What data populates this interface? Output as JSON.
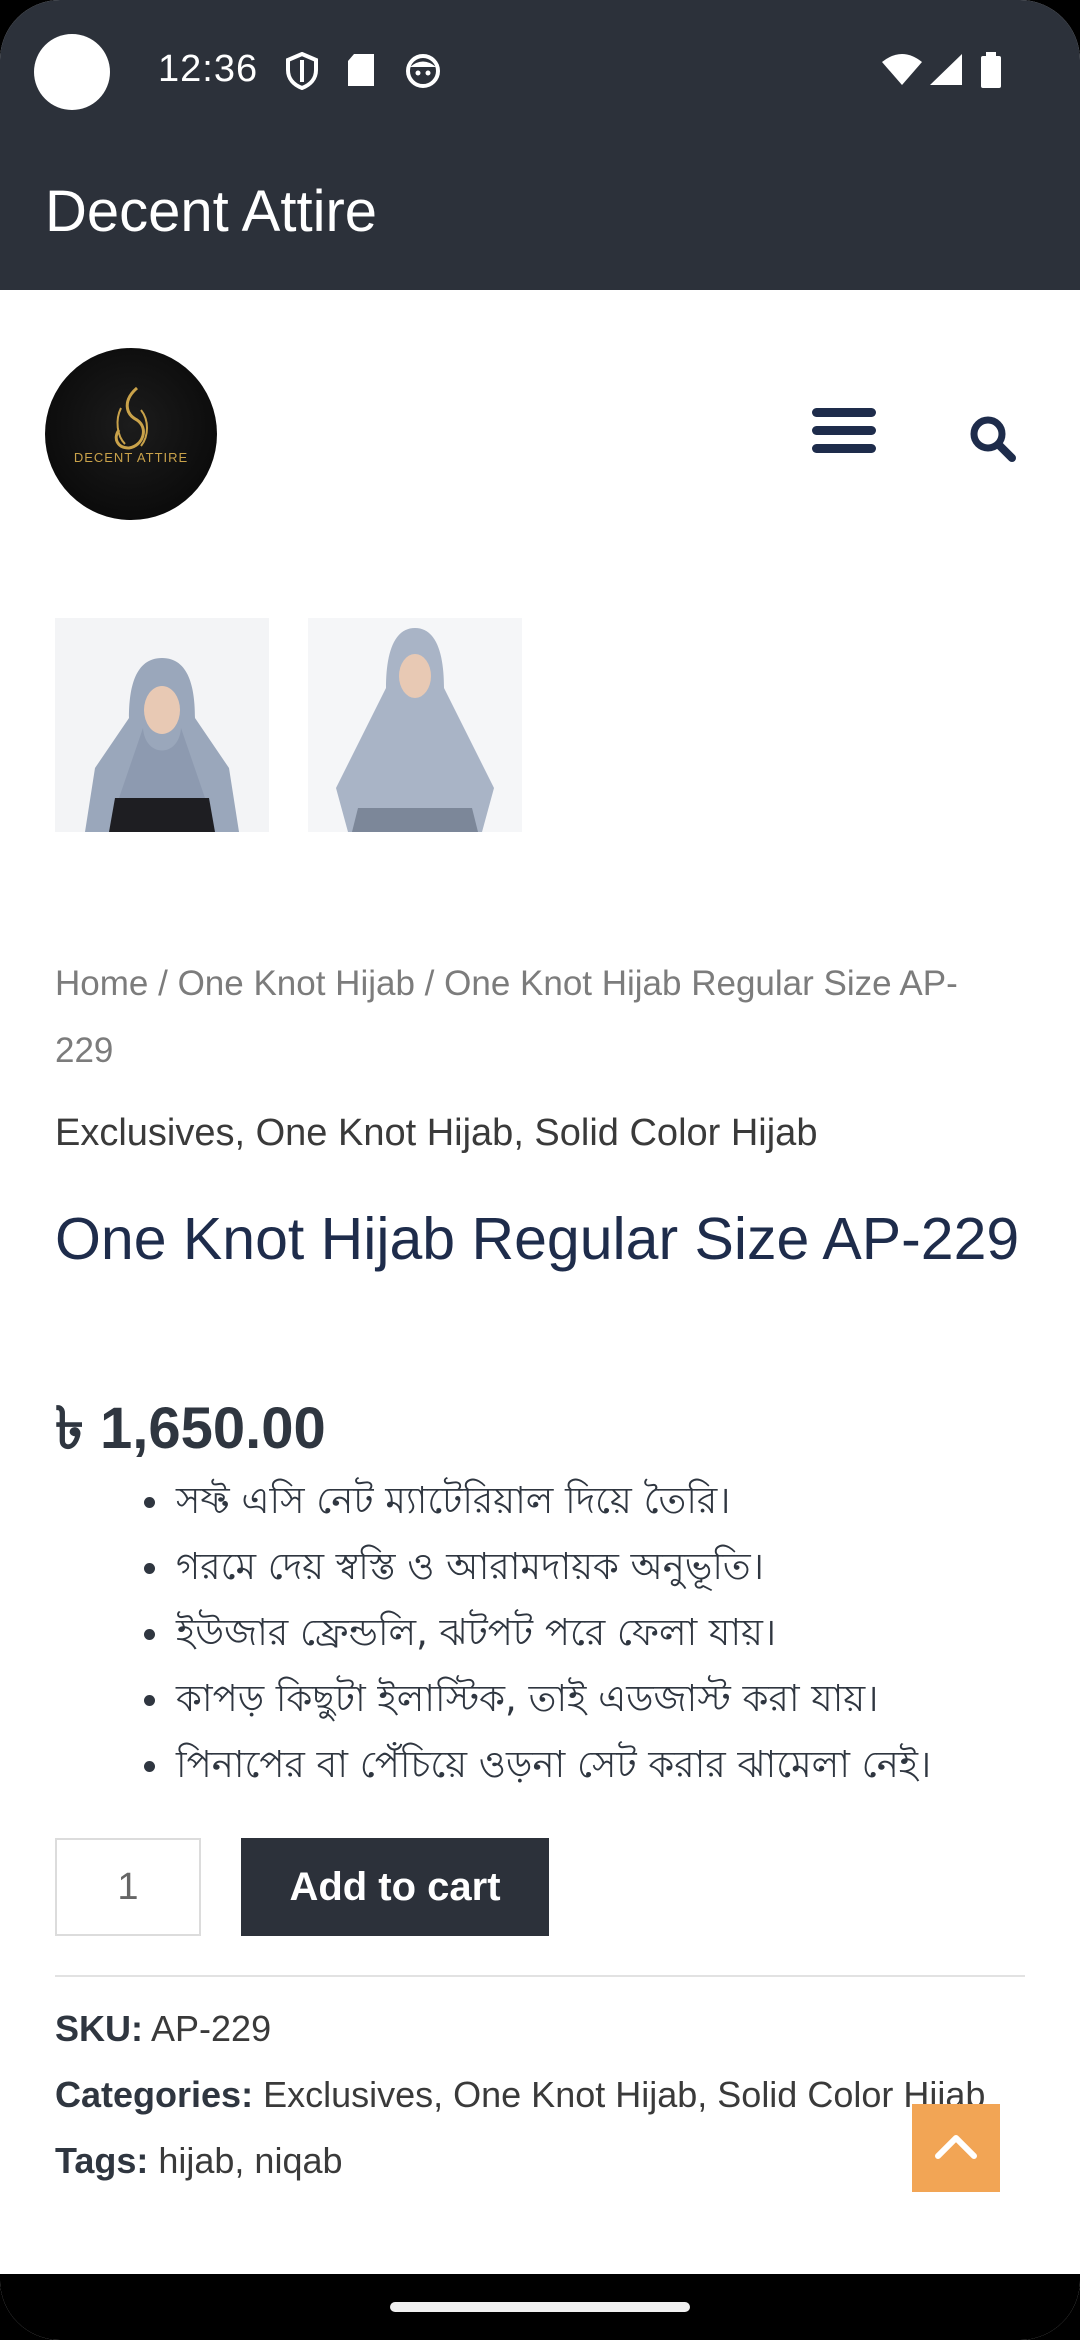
{
  "status_bar": {
    "time": "12:36",
    "icons": [
      "shield-icon",
      "sd-card-icon",
      "face-icon",
      "wifi-icon",
      "signal-icon",
      "battery-icon"
    ]
  },
  "app_bar": {
    "title": "Decent Attire"
  },
  "header": {
    "logo_text": "DECENT ATTIRE",
    "icons": [
      "menu-icon",
      "search-icon"
    ]
  },
  "breadcrumb": {
    "home": "Home",
    "separator": " / ",
    "category": "One Knot Hijab",
    "current": "One Knot Hijab Regular Size AP-229"
  },
  "product": {
    "categories_line": "Exclusives, One Knot Hijab, Solid Color Hijab",
    "title": "One Knot Hijab Regular Size AP-229",
    "price": "৳ 1,650.00",
    "features": [
      "সফ্ট এসি নেট ম্যাটেরিয়াল দিয়ে তৈরি।",
      "গরমে দেয় স্বস্তি ও আরামদায়ক অনুভূতি।",
      "ইউজার ফ্রেন্ডলি, ঝটপট পরে ফেলা যায়।",
      "কাপড় কিছুটা ইলাস্টিক, তাই এডজাস্ট করা যায়।",
      "পিনাপের বা পেঁচিয়ে ওড়না সেট করার ঝামেলা নেই।"
    ],
    "quantity": "1",
    "add_to_cart": "Add to cart"
  },
  "meta": {
    "sku_label": "SKU:",
    "sku_value": "AP-229",
    "categories_label": "Categories:",
    "categories_value": "Exclusives, One Knot Hijab, Solid Color Hijab",
    "tags_label": "Tags:",
    "tags_value": "hijab, niqab"
  },
  "colors": {
    "header_bg": "#2c313a",
    "title_color": "#1e2c4b",
    "scroll_top_bg": "#f2a555"
  }
}
